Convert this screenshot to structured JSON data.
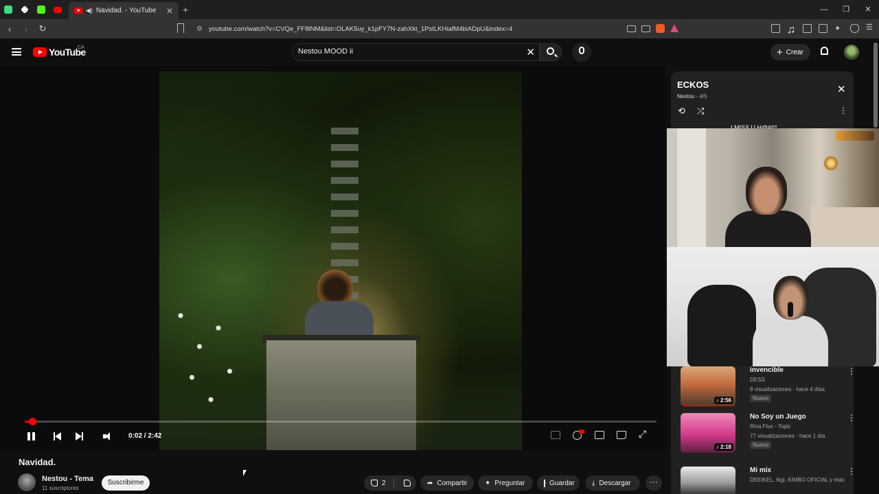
{
  "browser": {
    "tab_title": "Navidad. - YouTube",
    "new_tab": "+",
    "url": "youtube.com/watch?v=CVQe_FF8lNM&list=OLAK5uy_k1pFY7N-zahXkt_1PsILKHiafM4biADpU&index=4"
  },
  "header": {
    "logo_text": "YouTube",
    "country_code": "CA",
    "search_query": "Nestou MOOD ii",
    "create_label": "Crear"
  },
  "player": {
    "time": "0:02 / 2:42",
    "progress": 0.012
  },
  "video": {
    "title": "Navidad.",
    "channel_name": "Nestou - Tema",
    "subscribers": "11 suscriptores",
    "subscribe_label": "Suscribirme",
    "like_count": "2",
    "share_label": "Compartir",
    "ask_label": "Preguntar",
    "save_label": "Guardar",
    "download_label": "Descargar"
  },
  "playlist": {
    "title": "ECKOS",
    "owner": "Nestou",
    "position": "4/5",
    "peek_title": "I MISS U H@#!!*",
    "items": [
      {
        "title": "invencible",
        "channel": "DESS",
        "views": "8 visualizaciones · hace 4 días",
        "badge": "Nuevo",
        "duration": "2:56",
        "watched": 1.0
      },
      {
        "title": "No Soy un Juego",
        "channel": "Rina Flux - Topic",
        "views": "77 visualizaciones · hace 1 día",
        "badge": "Nuevo",
        "duration": "2:18"
      },
      {
        "title": "Mi mix",
        "channel": "DEEIKEL, 6igi, KIMBO OFICIAL y más"
      }
    ]
  },
  "colors": {
    "accent": "#ff0000",
    "background": "#0f0f0f",
    "panel": "#212121"
  }
}
